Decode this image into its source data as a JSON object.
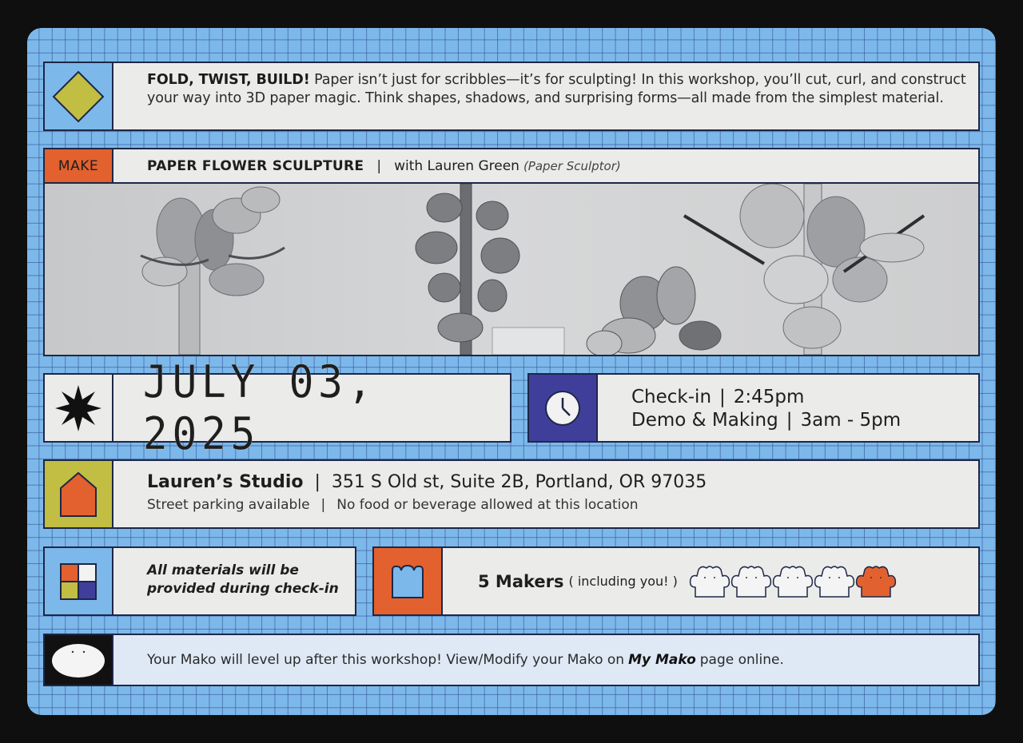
{
  "intro": {
    "headline": "FOLD, TWIST, BUILD!",
    "line1": "Paper isn’t just for scribbles—it’s for sculpting! In this workshop, you’ll cut, curl, and construct",
    "line2": "your way into 3D paper magic. Think shapes, shadows, and surprising forms—all made from the simplest material.",
    "icon": "diamond-icon"
  },
  "session": {
    "tag": "MAKE",
    "title": "PAPER FLOWER SCULPTURE",
    "divider": "|",
    "host": "with Lauren Green",
    "host_role": "(Paper Sculptor)"
  },
  "photo": {
    "subject": "paper flower sculptures"
  },
  "date": {
    "text": "JULY 03, 2025",
    "icon": "star-burst-icon"
  },
  "schedule": {
    "icon": "clock-icon",
    "checkin_label": "Check-in",
    "checkin_time": "2:45pm",
    "demo_label": "Demo & Making",
    "demo_time": "3am - 5pm",
    "divider": "|"
  },
  "location": {
    "icon": "house-icon",
    "name": "Lauren’s Studio",
    "address": "351 S Old st, Suite 2B, Portland, OR 97035",
    "parking": "Street parking available",
    "food": "No food or beverage allowed at this location",
    "divider": "|"
  },
  "materials": {
    "icon": "color-grid-icon",
    "line1": "All materials will be",
    "line2": "provided during check-in"
  },
  "makers": {
    "icon": "maker-icon",
    "count": "5 Makers",
    "note": "( including you! )",
    "total": 5,
    "highlighted_index": 4
  },
  "mako": {
    "icon": "mako-face-icon",
    "prefix": "Your Mako will level up after this workshop! View/Modify your Mako on",
    "link": "My Mako",
    "suffix": "page online."
  },
  "colors": {
    "background": "#0f0f0f",
    "card_blue": "#7db8ea",
    "panel": "#ebebea",
    "orange": "#e2612f",
    "olive": "#c2bd43",
    "indigo": "#3f3f9b",
    "navy_border": "#1d2747"
  }
}
